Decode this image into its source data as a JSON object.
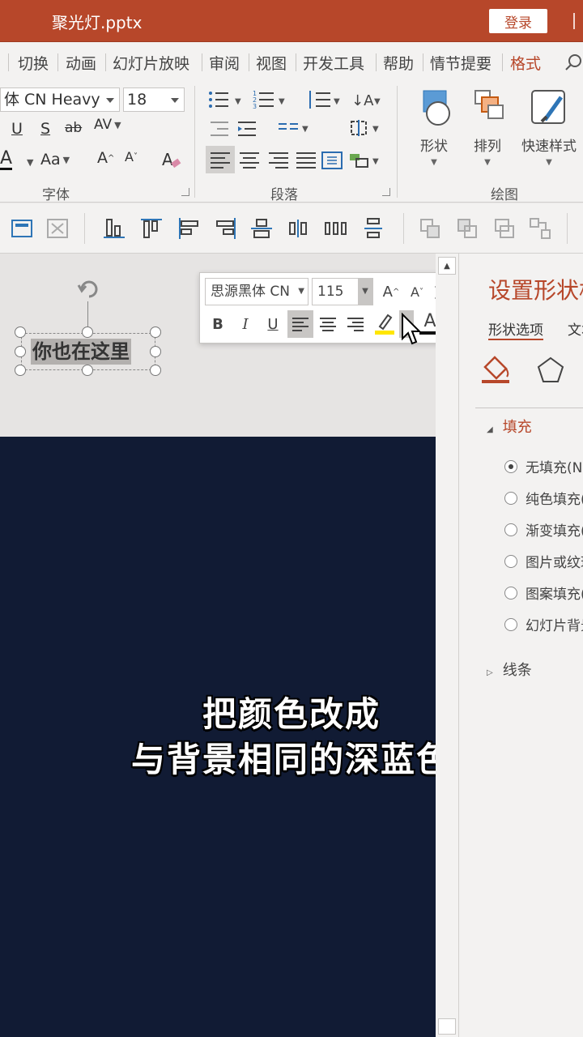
{
  "titlebar": {
    "file_name": "聚光灯.pptx",
    "login_label": "登录"
  },
  "menu": {
    "tabs": [
      {
        "label": "切换"
      },
      {
        "label": "动画"
      },
      {
        "label": "幻灯片放映"
      },
      {
        "label": "审阅"
      },
      {
        "label": "视图"
      },
      {
        "label": "开发工具"
      },
      {
        "label": "帮助"
      },
      {
        "label": "情节提要"
      },
      {
        "label": "格式",
        "active": true
      }
    ]
  },
  "ribbon": {
    "font_group": {
      "font_name": "体 CN Heavy",
      "font_size": "18",
      "underline": "U",
      "shadow": "S",
      "strike": "ab",
      "spacing": "AV",
      "font_color": "A",
      "change_case": "Aa",
      "grow": "A",
      "shrink": "A",
      "label": "字体"
    },
    "paragraph_group": {
      "label": "段落"
    },
    "drawing_group": {
      "shapes_label": "形状",
      "arrange_label": "排列",
      "quick_styles_label": "快速样式",
      "label": "绘图"
    }
  },
  "mini_toolbar": {
    "font_name": "思源黑体 CN",
    "font_size": "115",
    "bold": "B",
    "italic": "I",
    "underline": "U",
    "font_color": "A",
    "highlight_color": "#ffe600",
    "font_color_bar": "#111111"
  },
  "canvas": {
    "shape_text": "你也在这里",
    "slide_bg": "#111b34",
    "subtitle_line1": "把颜色改成",
    "subtitle_line2": "与背景相同的深蓝色"
  },
  "pane": {
    "title": "设置形状格式",
    "tabs": [
      "形状选项",
      "文本选项"
    ],
    "fill_section": "填充",
    "fill_options": [
      {
        "label": "无填充(N)",
        "selected": true
      },
      {
        "label": "纯色填充(S)",
        "selected": false
      },
      {
        "label": "渐变填充(G)",
        "selected": false
      },
      {
        "label": "图片或纹理填充(P)",
        "selected": false
      },
      {
        "label": "图案填充(A)",
        "selected": false
      },
      {
        "label": "幻灯片背景填充(B)",
        "selected": false
      }
    ],
    "line_section": "线条"
  },
  "colors": {
    "accent": "#b7472a",
    "ribbon_bg": "#f3f2f1",
    "slide_bg": "#111b34"
  }
}
